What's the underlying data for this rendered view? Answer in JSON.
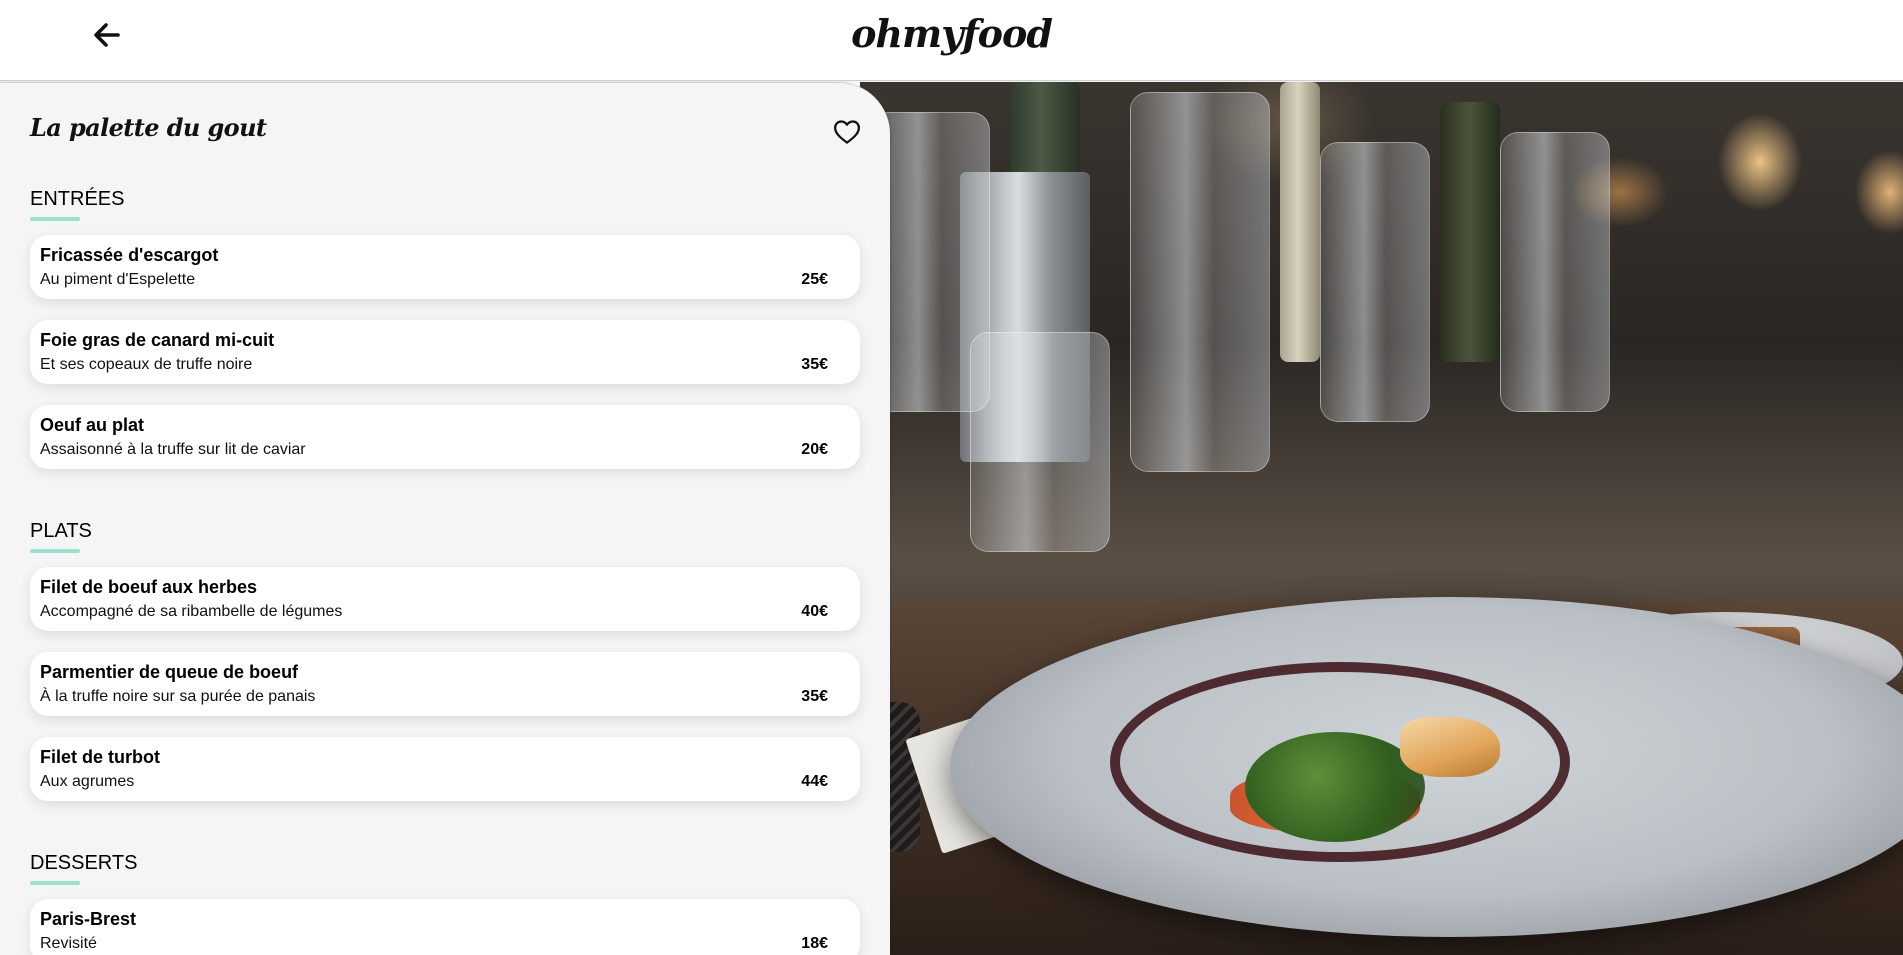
{
  "header": {
    "back_icon": "arrow-left-icon",
    "logo": "ohmyfood"
  },
  "restaurant": {
    "name": "La palette du gout",
    "favorite_icon": "heart-outline-icon"
  },
  "accent_color": "#99e2d0",
  "sections": [
    {
      "title": "ENTRÉES",
      "items": [
        {
          "name": "Fricassée d'escargot",
          "description": "Au piment d'Espelette",
          "price": "25€"
        },
        {
          "name": "Foie gras de canard mi-cuit",
          "description": "Et ses copeaux de truffe noire",
          "price": "35€"
        },
        {
          "name": "Oeuf au plat",
          "description": "Assaisonné à la truffe sur lit de caviar",
          "price": "20€"
        }
      ]
    },
    {
      "title": "PLATS",
      "items": [
        {
          "name": "Filet de boeuf aux herbes",
          "description": "Accompagné de sa ribambelle de légumes",
          "price": "40€"
        },
        {
          "name": "Parmentier de queue de boeuf",
          "description": "À la truffe noire sur sa purée de panais",
          "price": "35€"
        },
        {
          "name": "Filet de turbot",
          "description": "Aux agrumes",
          "price": "44€"
        }
      ]
    },
    {
      "title": "DESSERTS",
      "items": [
        {
          "name": "Paris-Brest",
          "description": "Revisité",
          "price": "18€"
        }
      ]
    }
  ]
}
